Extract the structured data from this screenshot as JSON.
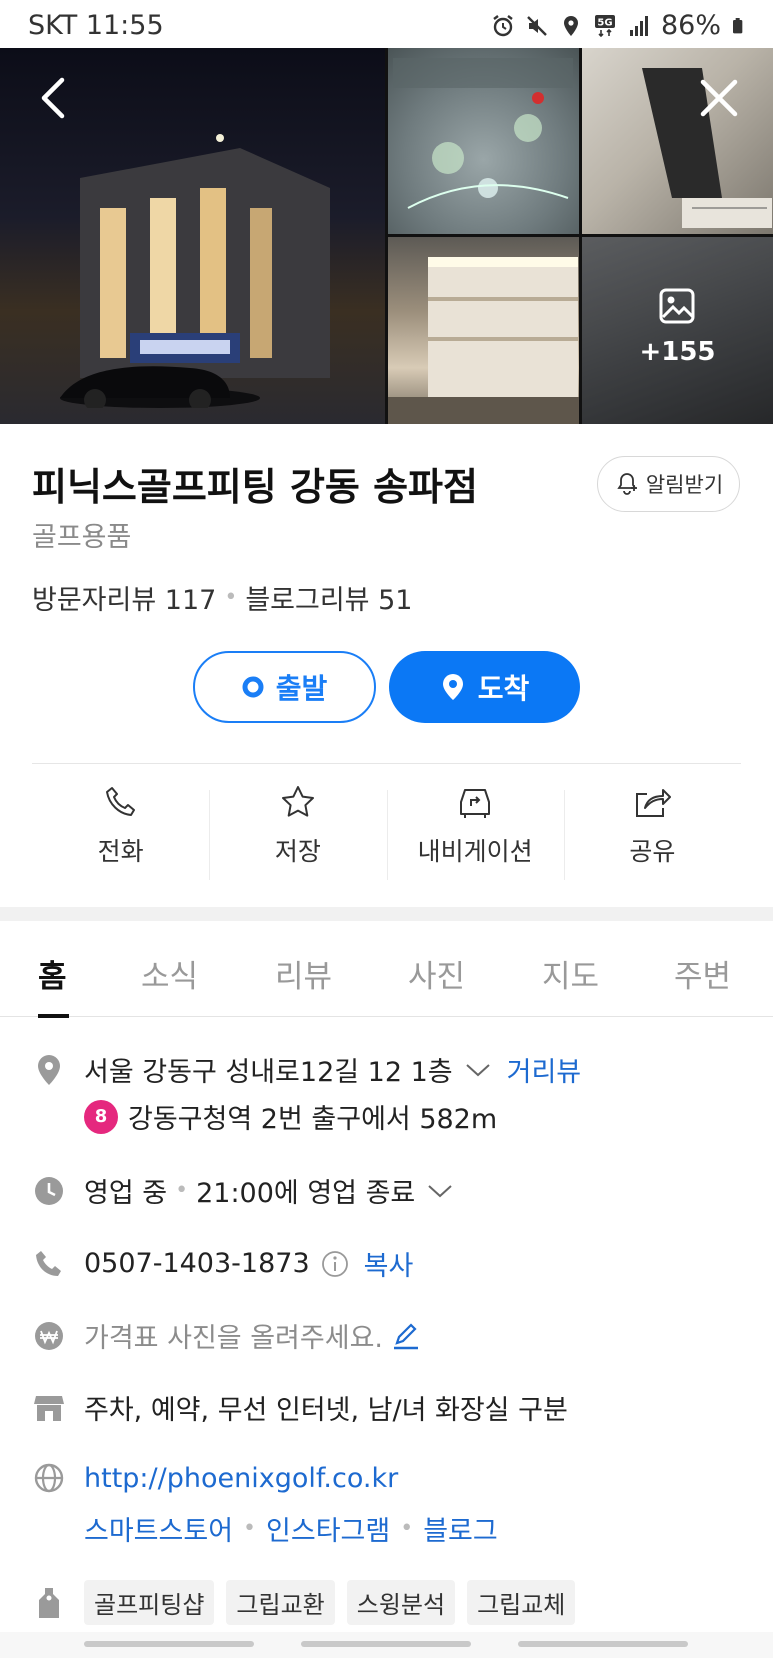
{
  "status_bar": {
    "carrier_time": "SKT 11:55",
    "battery": "86%"
  },
  "photos": {
    "more_count": "+155"
  },
  "place": {
    "title": "피닉스골프피팅 강동 송파점",
    "category": "골프용품",
    "alarm_label": "알림받기",
    "visitor_reviews": "방문자리뷰 117",
    "blog_reviews": "블로그리뷰 51"
  },
  "route": {
    "start_label": "출발",
    "end_label": "도착"
  },
  "actions": [
    {
      "label": "전화",
      "icon": "phone-icon"
    },
    {
      "label": "저장",
      "icon": "star-icon"
    },
    {
      "label": "내비게이션",
      "icon": "car-navigation-icon"
    },
    {
      "label": "공유",
      "icon": "share-icon"
    }
  ],
  "tabs": [
    {
      "label": "홈"
    },
    {
      "label": "소식"
    },
    {
      "label": "리뷰"
    },
    {
      "label": "사진"
    },
    {
      "label": "지도"
    },
    {
      "label": "주변"
    }
  ],
  "info": {
    "address": "서울 강동구 성내로12길 12 1층",
    "street_view": "거리뷰",
    "subway_line": "8",
    "subway_text": "강동구청역 2번 출구에서 582m",
    "hours_status": "영업 중",
    "hours_detail": "21:00에 영업 종료",
    "phone": "0507-1403-1873",
    "copy_label": "복사",
    "price_prompt": "가격표 사진을 올려주세요.",
    "amenities": "주차, 예약, 무선 인터넷, 남/녀 화장실 구분",
    "website": "http://phoenixgolf.co.kr",
    "links": [
      "스마트스토어",
      "인스타그램",
      "블로그"
    ],
    "tags": [
      "골프피팅샵",
      "그립교환",
      "스윙분석",
      "그립교체"
    ]
  },
  "colors": {
    "accent_blue": "#0b78f5",
    "link_blue": "#1d6ad0",
    "subway_line8": "#e5287e"
  }
}
